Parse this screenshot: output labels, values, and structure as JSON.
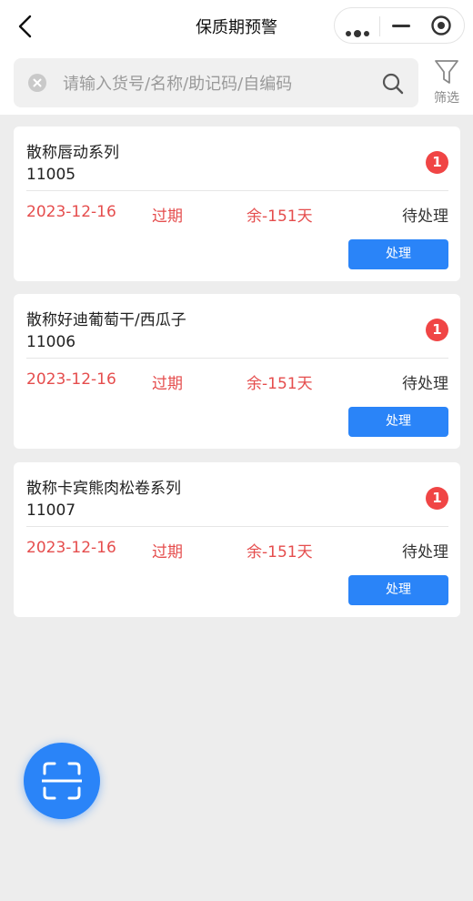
{
  "header": {
    "title": "保质期预警",
    "back_icon": "back-arrow-icon",
    "menu_icon": "more-dots-icon",
    "minimize_icon": "minimize-icon",
    "close_icon": "target-close-icon"
  },
  "search": {
    "placeholder": "请输入货号/名称/助记码/自编码",
    "value": "",
    "filter_label": "筛选"
  },
  "cards": [
    {
      "name": "散称唇动系列",
      "code": "11005",
      "badge": "1",
      "date": "2023-12-16",
      "expiry_status": "过期",
      "remaining": "余-151天",
      "status": "待处理",
      "action_label": "处理"
    },
    {
      "name": "散称好迪葡萄干/西瓜子",
      "code": "11006",
      "badge": "1",
      "date": "2023-12-16",
      "expiry_status": "过期",
      "remaining": "余-151天",
      "status": "待处理",
      "action_label": "处理"
    },
    {
      "name": "散称卡宾熊肉松卷系列",
      "code": "11007",
      "badge": "1",
      "date": "2023-12-16",
      "expiry_status": "过期",
      "remaining": "余-151天",
      "status": "待处理",
      "action_label": "处理"
    }
  ],
  "colors": {
    "accent": "#2a84f8",
    "warning": "#e54d4d",
    "badge": "#f04545",
    "background": "#ededed"
  },
  "fab": {
    "icon": "scan-icon"
  }
}
